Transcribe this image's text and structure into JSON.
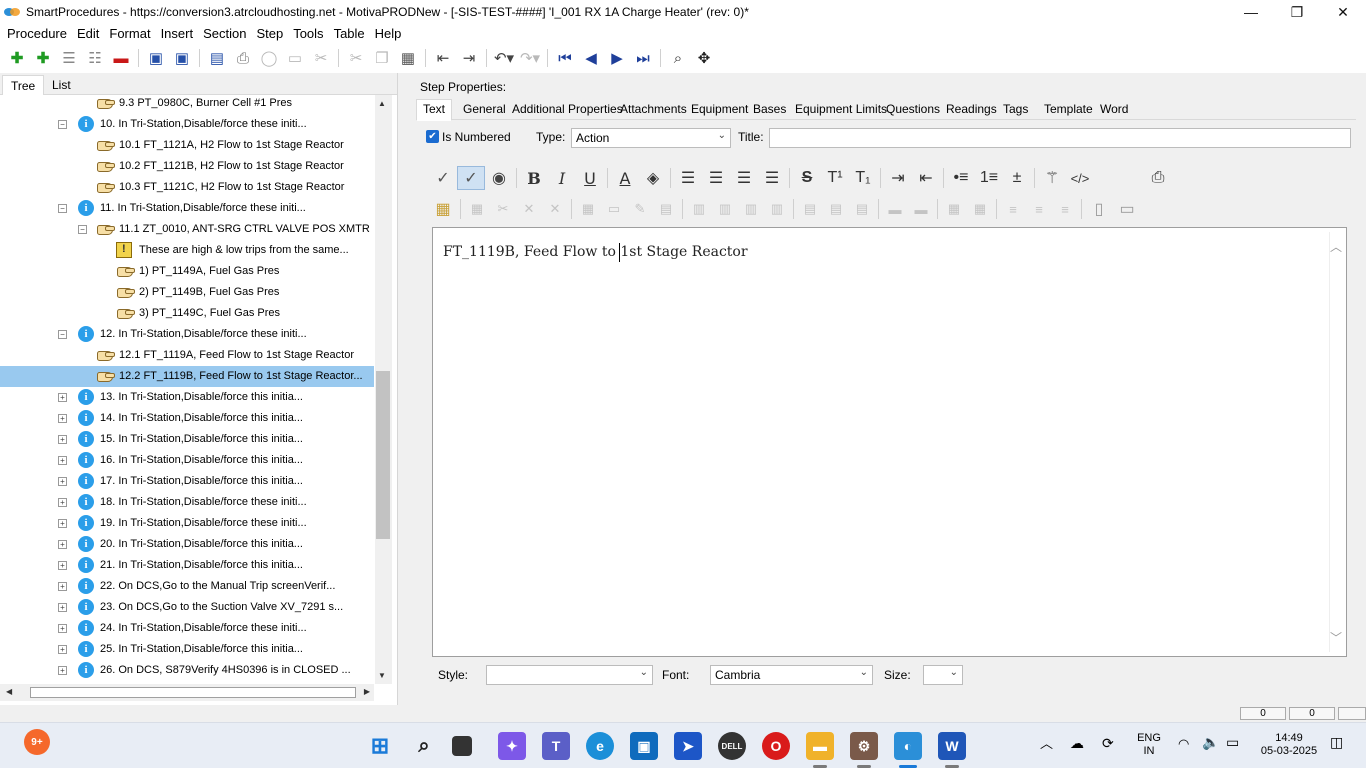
{
  "window": {
    "title": "SmartProcedures - https://conversion3.atrcloudhosting.net - MotivaPRODNew - [-SIS-TEST-####] 'I_001 RX 1A Charge Heater' (rev: 0)*",
    "minimize": "—",
    "maximize": "❐",
    "close": "✕"
  },
  "menu": [
    "Procedure",
    "Edit",
    "Format",
    "Insert",
    "Section",
    "Step",
    "Tools",
    "Table",
    "Help"
  ],
  "left_tabs": {
    "tree": "Tree",
    "list": "List"
  },
  "tree": [
    {
      "label": "9.3 PT_0980C, Burner Cell #1 Pres",
      "icon": "hand"
    },
    {
      "label": "10. In Tri-Station,Disable/force these initi...",
      "icon": "info",
      "expander": "−"
    },
    {
      "label": "10.1 FT_1121A, H2 Flow to 1st Stage Reactor",
      "icon": "hand"
    },
    {
      "label": "10.2 FT_1121B, H2 Flow to 1st Stage Reactor",
      "icon": "hand"
    },
    {
      "label": "10.3 FT_1121C, H2 Flow to 1st Stage Reactor",
      "icon": "hand"
    },
    {
      "label": "11. In Tri-Station,Disable/force these initi...",
      "icon": "info",
      "expander": "−"
    },
    {
      "label": "11.1 ZT_0010, ANT-SRG CTRL VALVE POS XMTR",
      "icon": "hand",
      "expander": "−"
    },
    {
      "label": "These are high & low trips from the same...",
      "icon": "warn"
    },
    {
      "label": "1) PT_1149A, Fuel Gas Pres",
      "icon": "hand"
    },
    {
      "label": "2) PT_1149B, Fuel Gas Pres",
      "icon": "hand"
    },
    {
      "label": "3) PT_1149C, Fuel Gas Pres",
      "icon": "hand"
    },
    {
      "label": "12. In Tri-Station,Disable/force these initi...",
      "icon": "info",
      "expander": "−"
    },
    {
      "label": "12.1 FT_1119A, Feed Flow to 1st Stage Reactor",
      "icon": "hand"
    },
    {
      "label": "12.2 FT_1119B, Feed Flow to 1st Stage Reactor...",
      "icon": "hand",
      "selected": true
    },
    {
      "label": "13. In Tri-Station,Disable/force this initia...",
      "icon": "info",
      "expander": "+"
    },
    {
      "label": "14. In Tri-Station,Disable/force this initia...",
      "icon": "info",
      "expander": "+"
    },
    {
      "label": "15. In Tri-Station,Disable/force this initia...",
      "icon": "info",
      "expander": "+"
    },
    {
      "label": "16. In Tri-Station,Disable/force this initia...",
      "icon": "info",
      "expander": "+"
    },
    {
      "label": "17. In Tri-Station,Disable/force this initia...",
      "icon": "info",
      "expander": "+"
    },
    {
      "label": "18. In Tri-Station,Disable/force these initi...",
      "icon": "info",
      "expander": "+"
    },
    {
      "label": "19. In Tri-Station,Disable/force these initi...",
      "icon": "info",
      "expander": "+"
    },
    {
      "label": "20. In Tri-Station,Disable/force this initia...",
      "icon": "info",
      "expander": "+"
    },
    {
      "label": "21. In Tri-Station,Disable/force this initia...",
      "icon": "info",
      "expander": "+"
    },
    {
      "label": "22. On DCS,Go to the Manual Trip screenVerif...",
      "icon": "info",
      "expander": "+"
    },
    {
      "label": "23. On DCS,Go to the Suction Valve XV_7291 s...",
      "icon": "info",
      "expander": "+"
    },
    {
      "label": "24. In Tri-Station,Disable/force these initi...",
      "icon": "info",
      "expander": "+"
    },
    {
      "label": "25. In Tri-Station,Disable/force this initia...",
      "icon": "info",
      "expander": "+"
    },
    {
      "label": "26. On DCS, S879Verify 4HS0396 is in CLOSED ...",
      "icon": "info",
      "expander": "+"
    }
  ],
  "step_properties": {
    "label": "Step Properties:",
    "tabs": [
      "Text",
      "General",
      "Additional Properties",
      "Attachments",
      "Equipment",
      "Bases",
      "Equipment Limits",
      "Questions",
      "Readings",
      "Tags",
      "Template",
      "Word"
    ],
    "is_numbered_label": "Is Numbered",
    "type_label": "Type:",
    "type_value": "Action",
    "title_label": "Title:",
    "title_value": ""
  },
  "editor": {
    "text": "FT_1119B, Feed Flow to 1st Stage Reactor"
  },
  "bottom": {
    "style_label": "Style:",
    "style_value": "",
    "font_label": "Font:",
    "font_value": "Cambria",
    "size_label": "Size:",
    "size_value": ""
  },
  "status": {
    "box1": "0",
    "box2": "0"
  },
  "taskbar": {
    "notification_badge": "9+",
    "lang_line1": "ENG",
    "lang_line2": "IN",
    "time": "14:49",
    "date": "05-03-2025"
  },
  "colors": {
    "selected_row": "#99c9ef",
    "info_icon": "#2b9ee9",
    "checkbox": "#1a6bd0"
  }
}
